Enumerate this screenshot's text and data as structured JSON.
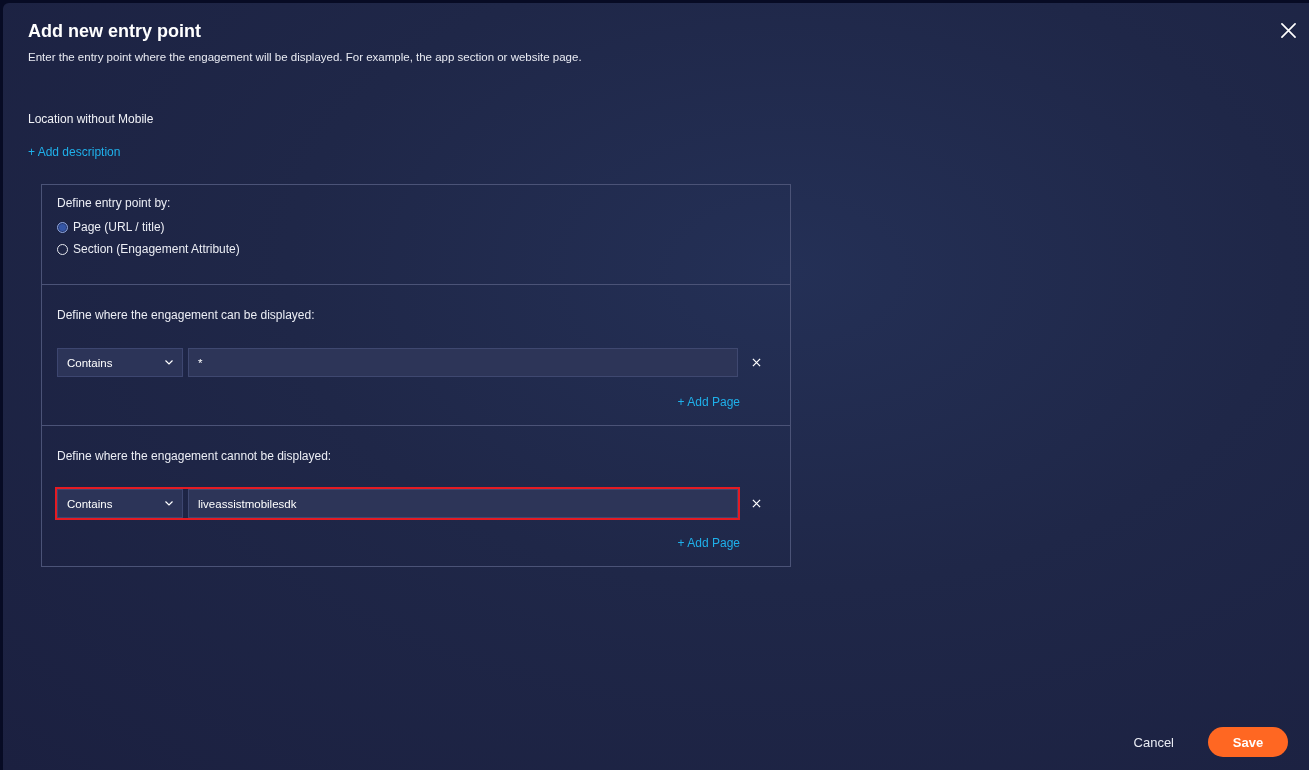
{
  "dialog": {
    "title": "Add new entry point",
    "subtitle": "Enter the entry point where the engagement will be displayed. For example, the app section or website page.",
    "entry_point_name": "Location without Mobile",
    "add_description_link": "+ Add description",
    "define_by": {
      "label": "Define entry point by:",
      "options": [
        {
          "label": "Page (URL / title)",
          "selected": true
        },
        {
          "label": "Section (Engagement Attribute)",
          "selected": false
        }
      ]
    },
    "rule_sections": [
      {
        "heading": "Define where the engagement can be displayed:",
        "rules": [
          {
            "operator": "Contains",
            "value": "*",
            "highlighted": false
          }
        ],
        "add_link": "+ Add Page"
      },
      {
        "heading": "Define where the engagement cannot be displayed:",
        "rules": [
          {
            "operator": "Contains",
            "value": "liveassistmobilesdk",
            "highlighted": true
          }
        ],
        "add_link": "+ Add Page"
      }
    ],
    "buttons": [
      {
        "label": "Cancel",
        "kind": "text"
      },
      {
        "label": "Save",
        "kind": "primary"
      }
    ]
  }
}
